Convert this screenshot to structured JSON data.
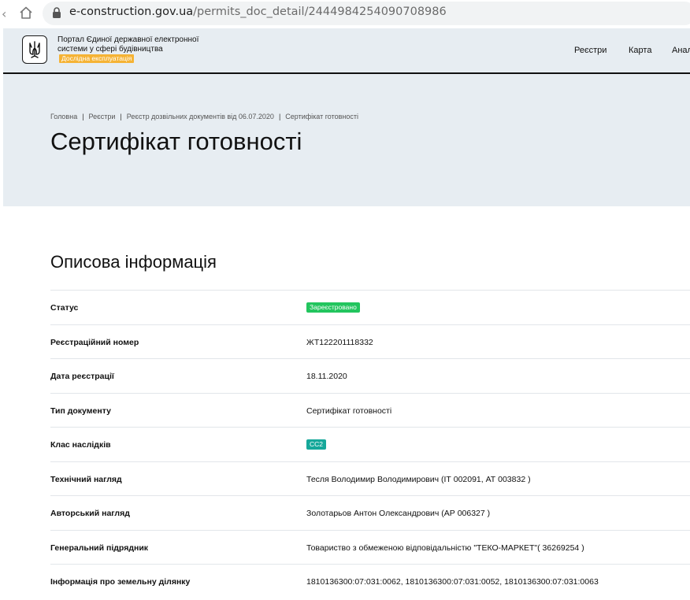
{
  "browser": {
    "url_domain": "e-construction.gov.ua",
    "url_path": "/permits_doc_detail/2444984254090708986"
  },
  "header": {
    "portal_title": "Портал Єдиної державної електронної системи у сфері будівництва",
    "pilot_badge": "Дослідна експлуатація",
    "nav": [
      "Реєстри",
      "Карта",
      "Анал"
    ]
  },
  "breadcrumb": [
    "Головна",
    "Реєстри",
    "Реєстр дозвільних документів від 06.07.2020",
    "Сертифікат готовності"
  ],
  "page_title": "Сертифікат готовності",
  "section_title": "Описова інформація",
  "rows": [
    {
      "label": "Статус",
      "value": "Зареєстровано",
      "pill_color": "#22c55e"
    },
    {
      "label": "Реєстраційний номер",
      "value": "ЖТ122201118332"
    },
    {
      "label": "Дата реєстрації",
      "value": "18.11.2020"
    },
    {
      "label": "Тип документу",
      "value": "Сертифікат готовності"
    },
    {
      "label": "Клас наслідків",
      "value": "СС2",
      "pill_color": "#16a89a"
    },
    {
      "label": "Технічний нагляд",
      "value": "Тесля Володимир Володимирович (ІТ 002091, АТ 003832 )"
    },
    {
      "label": "Авторський нагляд",
      "value": "Золотарьов Антон Олександрович (АР 006327 )"
    },
    {
      "label": "Генеральний підрядник",
      "value": "Товариство з обмеженою відповідальністю \"ТЕКО-МАРКЕТ\"( 36269254 )"
    },
    {
      "label": "Інформація про земельну ділянку",
      "value": "1810136300:07:031:0062, 1810136300:07:031:0052, 1810136300:07:031:0063"
    }
  ],
  "colors": {
    "hero_bg": "#e7edf2",
    "badge_pilot": "#f5b335"
  }
}
